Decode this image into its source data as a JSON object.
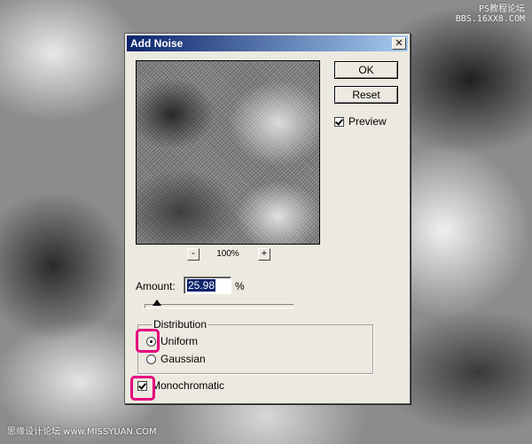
{
  "watermark": {
    "top_line1": "PS教程论坛",
    "top_line2": "BBS.16XX8.COM",
    "bottom": "思缘设计论坛 www.MISSYUAN.COM"
  },
  "dialog": {
    "title": "Add Noise",
    "close_symbol": "✕",
    "ok_label": "OK",
    "reset_label": "Reset",
    "preview_label": "Preview",
    "preview_checked": true,
    "zoom_out_symbol": "-",
    "zoom_in_symbol": "+",
    "zoom_level": "100%",
    "amount_label": "Amount:",
    "amount_value": "25.98",
    "amount_unit": "%",
    "amount_slider_percent": 8,
    "distribution_label": "Distribution",
    "distribution_options": [
      "Uniform",
      "Gaussian"
    ],
    "distribution_selected": "Uniform",
    "monochromatic_label": "Monochromatic",
    "monochromatic_checked": true
  },
  "colors": {
    "highlight": "#e4007f",
    "titlebar_start": "#0a246a",
    "titlebar_end": "#a6caf0",
    "selection": "#0a246a"
  },
  "icons": {
    "close": "close-icon",
    "zoom_out": "minus-icon",
    "zoom_in": "plus-icon"
  }
}
